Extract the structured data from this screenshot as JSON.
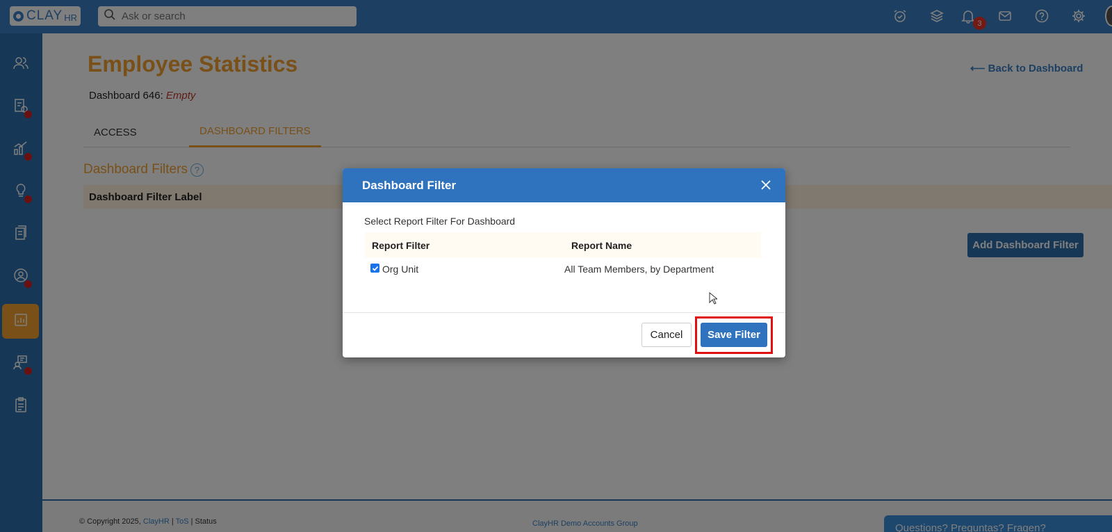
{
  "app": {
    "logo_text": "CLAY",
    "logo_suffix": "HR"
  },
  "search": {
    "placeholder": "Ask or search"
  },
  "topbar": {
    "icons": [
      "alarm-icon",
      "layers-icon",
      "bell-icon",
      "mail-icon",
      "help-icon",
      "gear-icon"
    ],
    "notification_count": "3"
  },
  "sidebar": {
    "items": [
      {
        "icon": "people-icon",
        "dot": false,
        "active": false
      },
      {
        "icon": "payroll-icon",
        "dot": true,
        "active": false
      },
      {
        "icon": "performance-chart-icon",
        "dot": true,
        "active": false
      },
      {
        "icon": "ideas-icon",
        "dot": true,
        "active": false
      },
      {
        "icon": "documents-icon",
        "dot": false,
        "active": false
      },
      {
        "icon": "profile-icon",
        "dot": true,
        "active": false
      },
      {
        "icon": "reports-icon",
        "dot": false,
        "active": true
      },
      {
        "icon": "workflow-icon",
        "dot": true,
        "active": false
      },
      {
        "icon": "clipboard-icon",
        "dot": false,
        "active": false
      }
    ]
  },
  "page": {
    "title": "Employee Statistics",
    "back_link": "Back to Dashboard",
    "dashboard_prefix": "Dashboard 646:",
    "dashboard_status": "Empty",
    "tabs": [
      {
        "label": "ACCESS",
        "active": false
      },
      {
        "label": "DASHBOARD FILTERS",
        "active": true
      }
    ],
    "section_title": "Dashboard Filters",
    "table_header": "Dashboard Filter Label",
    "add_button": "Add Dashboard Filter"
  },
  "modal": {
    "title": "Dashboard Filter",
    "subtitle": "Select Report Filter For Dashboard",
    "columns": [
      "Report Filter",
      "Report Name"
    ],
    "rows": [
      {
        "checked": true,
        "filter": "Org Unit",
        "report": "All Team Members, by Department"
      }
    ],
    "cancel_label": "Cancel",
    "save_label": "Save Filter"
  },
  "footer": {
    "copyright": "© Copyright 2025,",
    "company_link": "ClayHR",
    "sep": "|",
    "tos_link": "ToS",
    "status_link": "Status",
    "group": "ClayHR Demo Accounts Group"
  },
  "chat": {
    "label": "Questions? Preguntas? Fragen?"
  },
  "colors": {
    "brand": "#3a7fc4",
    "accent": "#f0a030",
    "highlight": "#e01010",
    "badge": "#e8342b"
  }
}
